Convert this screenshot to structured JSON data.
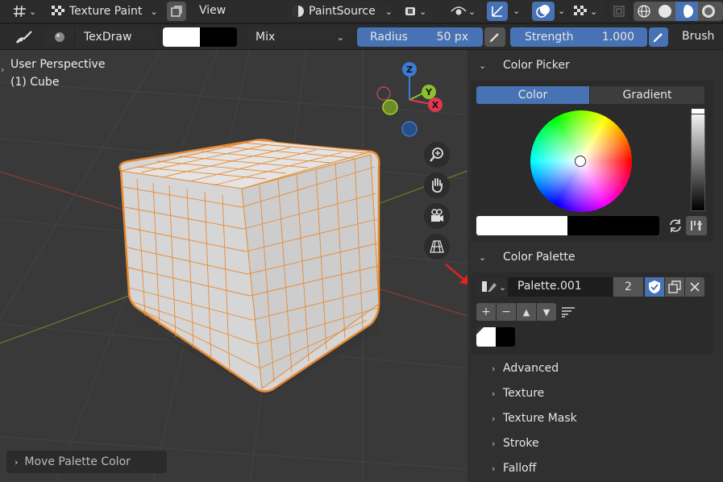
{
  "header": {
    "mode_label": "Texture Paint",
    "view_label": "View",
    "paint_source_label": "PaintSource"
  },
  "toolsettings": {
    "brush_name": "TexDraw",
    "blend_mode": "Mix",
    "radius_label": "Radius",
    "radius_value": "50 px",
    "strength_label": "Strength",
    "strength_value": "1.000",
    "brush_menu": "Brush"
  },
  "viewport": {
    "perspective_label": "User Perspective",
    "object_label": "(1) Cube",
    "gizmo": {
      "z": "Z",
      "y": "Y",
      "x": "X"
    },
    "last_operator": "Move Palette Color"
  },
  "panel": {
    "color_picker": {
      "title": "Color Picker",
      "tab_color": "Color",
      "tab_gradient": "Gradient"
    },
    "color_palette": {
      "title": "Color Palette",
      "palette_name": "Palette.001",
      "users_count": "2"
    },
    "sections": [
      "Advanced",
      "Texture",
      "Texture Mask",
      "Stroke",
      "Falloff"
    ]
  },
  "colors": {
    "accent": "#4772b3",
    "primary_swatch": "#ffffff",
    "secondary_swatch": "#000000",
    "wire": "#e8892f",
    "annotation_arrow": "#e4231b"
  }
}
